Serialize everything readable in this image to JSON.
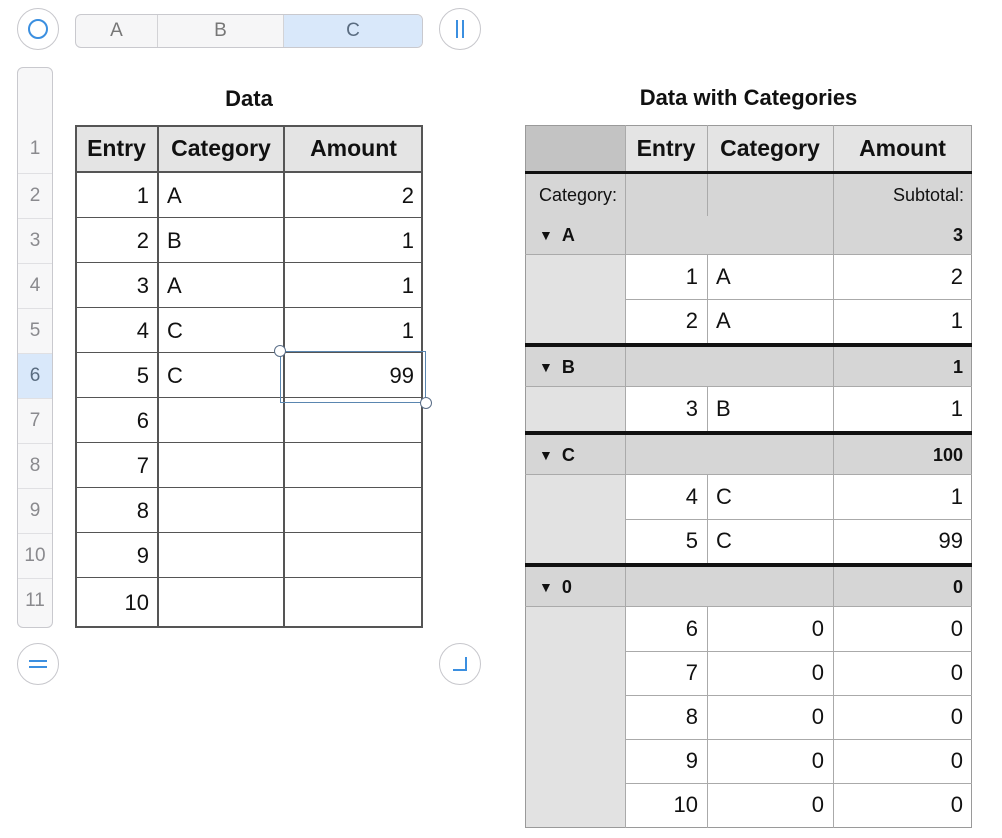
{
  "column_headers": [
    "A",
    "B",
    "C"
  ],
  "selected_column": "C",
  "row_headers": [
    "1",
    "2",
    "3",
    "4",
    "5",
    "6",
    "7",
    "8",
    "9",
    "10",
    "11"
  ],
  "selected_row": "6",
  "table1": {
    "title": "Data",
    "headers": [
      "Entry",
      "Category",
      "Amount"
    ],
    "rows": [
      [
        "1",
        "A",
        "2"
      ],
      [
        "2",
        "B",
        "1"
      ],
      [
        "3",
        "A",
        "1"
      ],
      [
        "4",
        "C",
        "1"
      ],
      [
        "5",
        "C",
        "99"
      ],
      [
        "6",
        "",
        ""
      ],
      [
        "7",
        "",
        ""
      ],
      [
        "8",
        "",
        ""
      ],
      [
        "9",
        "",
        ""
      ],
      [
        "10",
        "",
        ""
      ]
    ]
  },
  "table2": {
    "title": "Data with Categories",
    "headers": [
      "",
      "Entry",
      "Category",
      "Amount"
    ],
    "category_label": "Category:",
    "subtotal_label": "Subtotal:",
    "groups": [
      {
        "name": "A",
        "subtotal": "3",
        "rows": [
          [
            "1",
            "A",
            "2"
          ],
          [
            "2",
            "A",
            "1"
          ]
        ]
      },
      {
        "name": "B",
        "subtotal": "1",
        "rows": [
          [
            "3",
            "B",
            "1"
          ]
        ]
      },
      {
        "name": "C",
        "subtotal": "100",
        "rows": [
          [
            "4",
            "C",
            "1"
          ],
          [
            "5",
            "C",
            "99"
          ]
        ]
      },
      {
        "name": "0",
        "subtotal": "0",
        "rows": [
          [
            "6",
            "0",
            "0"
          ],
          [
            "7",
            "0",
            "0"
          ],
          [
            "8",
            "0",
            "0"
          ],
          [
            "9",
            "0",
            "0"
          ],
          [
            "10",
            "0",
            "0"
          ]
        ]
      }
    ]
  },
  "colors": {
    "accent": "#4a90d9",
    "selection_bg": "#d9e8fa",
    "header_gray": "#e4e4e4",
    "group_gray": "#d6d6d6"
  },
  "icons": {
    "top_left": "table-select-icon",
    "top_right": "add-column-icon",
    "bottom_left": "add-row-icon",
    "bottom_right": "resize-table-icon"
  }
}
